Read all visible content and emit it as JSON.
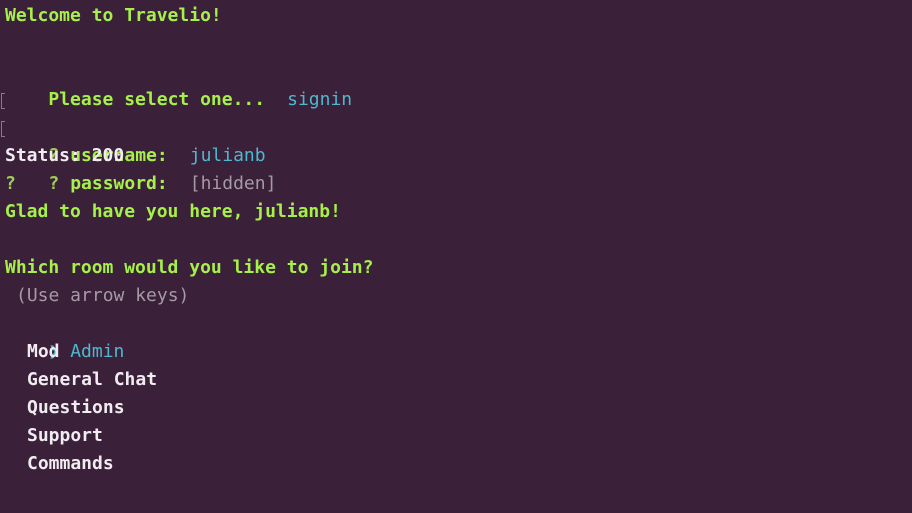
{
  "welcome": "Welcome to Travelio!",
  "select": {
    "prompt": "Please select one...",
    "answer": "signin"
  },
  "username": {
    "mark": "?",
    "label": "username:",
    "value": "julianb"
  },
  "password": {
    "mark": "?",
    "label": "password:",
    "value": "[hidden]"
  },
  "status": "Status: 200",
  "empty_prompt": "?",
  "greeting": "Glad to have you here, julianb!",
  "room_question": "Which room would you like to join?",
  "hint": "(Use arrow keys)",
  "pointer_symbol": "❯",
  "rooms": [
    "Admin",
    "Mod",
    "General Chat",
    "Questions",
    "Support",
    "Commands"
  ],
  "selected_room": "Admin",
  "colors": {
    "background": "#3a2039",
    "prompt_green": "#a6f04a",
    "answer_cyan": "#4db8d0",
    "hint_gray": "#a59aa5",
    "text_white": "#f0ecf0"
  }
}
